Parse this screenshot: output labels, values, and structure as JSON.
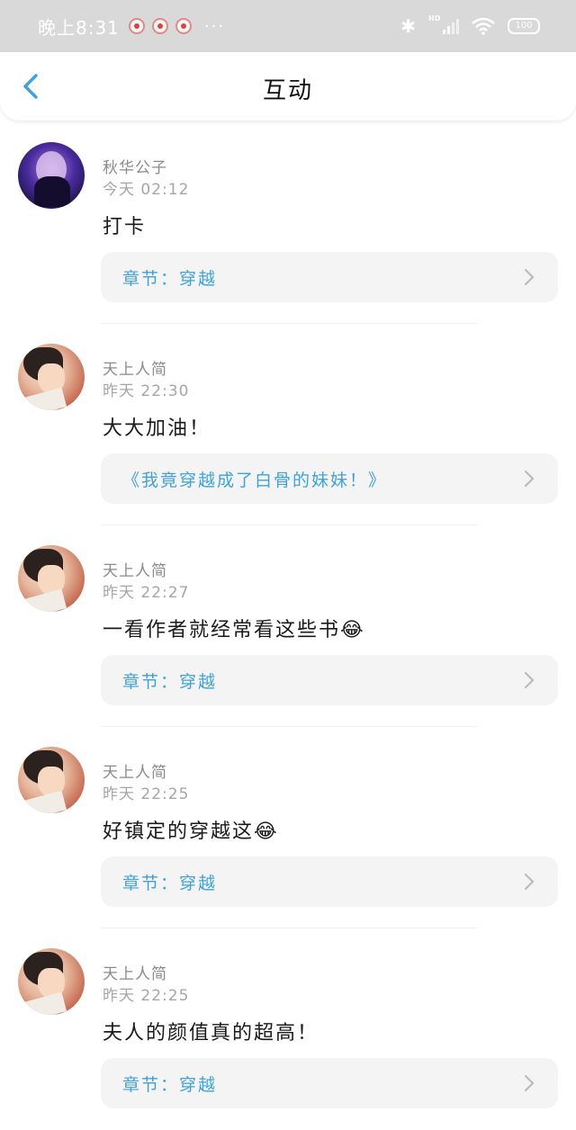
{
  "status_bar": {
    "time": "晚上8:31",
    "more": "···",
    "battery": "100",
    "signal_label": "HD"
  },
  "header": {
    "title": "互动"
  },
  "comments": [
    {
      "username": "秋华公子",
      "time": "今天 02:12",
      "text": "打卡",
      "reference": "章节：穿越"
    },
    {
      "username": "天上人简",
      "time": "昨天 22:30",
      "text": "大大加油！",
      "reference": "《我竟穿越成了白骨的妹妹！》"
    },
    {
      "username": "天上人简",
      "time": "昨天 22:27",
      "text": "一看作者就经常看这些书😂",
      "reference": "章节：穿越"
    },
    {
      "username": "天上人简",
      "time": "昨天 22:25",
      "text": "好镇定的穿越这😂",
      "reference": "章节：穿越"
    },
    {
      "username": "天上人简",
      "time": "昨天 22:25",
      "text": "夫人的颜值真的超高！",
      "reference": "章节：穿越"
    }
  ],
  "colors": {
    "accent": "#3fa2d9",
    "status_bar_bg": "#d9d9d9",
    "card_bg": "#f4f4f4"
  },
  "icons": [
    "back-arrow-icon",
    "chevron-right-icon",
    "bluetooth-icon",
    "wifi-icon",
    "signal-icon",
    "battery-icon"
  ]
}
